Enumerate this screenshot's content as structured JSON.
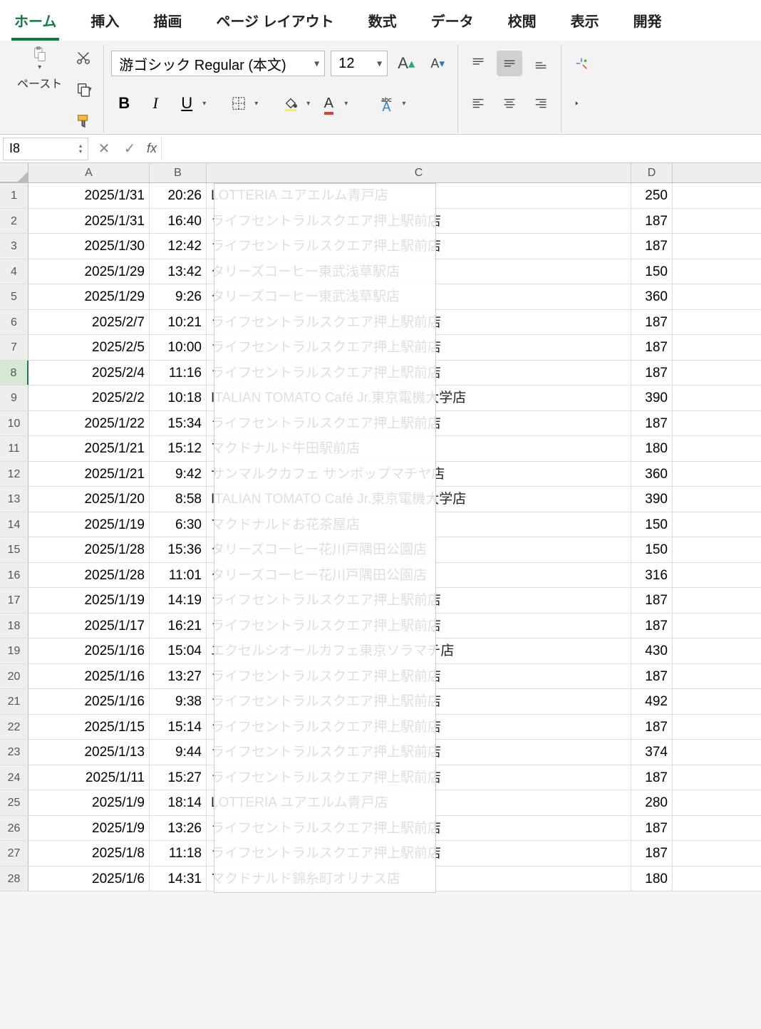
{
  "ribbon": {
    "tabs": [
      "ホーム",
      "挿入",
      "描画",
      "ページ レイアウト",
      "数式",
      "データ",
      "校閲",
      "表示",
      "開発"
    ],
    "activeTab": 0,
    "pasteLabel": "ペースト",
    "fontName": "游ゴシック Regular (本文)",
    "fontSize": "12"
  },
  "nameBox": "I8",
  "formula": "",
  "columns": [
    "A",
    "B",
    "C",
    "D"
  ],
  "rows": [
    {
      "n": 1,
      "a": "2025/1/31",
      "b": "20:26",
      "c": "LOTTERIA ユアエルム青戸店",
      "d": "250"
    },
    {
      "n": 2,
      "a": "2025/1/31",
      "b": "16:40",
      "c": "ライフセントラルスクエア押上駅前店",
      "d": "187"
    },
    {
      "n": 3,
      "a": "2025/1/30",
      "b": "12:42",
      "c": "ライフセントラルスクエア押上駅前店",
      "d": "187"
    },
    {
      "n": 4,
      "a": "2025/1/29",
      "b": "13:42",
      "c": "タリーズコーヒー東武浅草駅店",
      "d": "150"
    },
    {
      "n": 5,
      "a": "2025/1/29",
      "b": "9:26",
      "c": "タリーズコーヒー東武浅草駅店",
      "d": "360"
    },
    {
      "n": 6,
      "a": "2025/2/7",
      "b": "10:21",
      "c": "ライフセントラルスクエア押上駅前店",
      "d": "187"
    },
    {
      "n": 7,
      "a": "2025/2/5",
      "b": "10:00",
      "c": "ライフセントラルスクエア押上駅前店",
      "d": "187"
    },
    {
      "n": 8,
      "a": "2025/2/4",
      "b": "11:16",
      "c": "ライフセントラルスクエア押上駅前店",
      "d": "187",
      "sel": true
    },
    {
      "n": 9,
      "a": "2025/2/2",
      "b": "10:18",
      "c": "ITALIAN TOMATO Café Jr.東京電機大学店",
      "d": "390"
    },
    {
      "n": 10,
      "a": "2025/1/22",
      "b": "15:34",
      "c": "ライフセントラルスクエア押上駅前店",
      "d": "187"
    },
    {
      "n": 11,
      "a": "2025/1/21",
      "b": "15:12",
      "c": "マクドナルド牛田駅前店",
      "d": "180"
    },
    {
      "n": 12,
      "a": "2025/1/21",
      "b": "9:42",
      "c": "サンマルクカフェ サンポップマチヤ店",
      "d": "360"
    },
    {
      "n": 13,
      "a": "2025/1/20",
      "b": "8:58",
      "c": "ITALIAN TOMATO Café Jr.東京電機大学店",
      "d": "390"
    },
    {
      "n": 14,
      "a": "2025/1/19",
      "b": "6:30",
      "c": "マクドナルドお花茶屋店",
      "d": "150"
    },
    {
      "n": 15,
      "a": "2025/1/28",
      "b": "15:36",
      "c": "タリーズコーヒー花川戸隅田公園店",
      "d": "150"
    },
    {
      "n": 16,
      "a": "2025/1/28",
      "b": "11:01",
      "c": "タリーズコーヒー花川戸隅田公園店",
      "d": "316"
    },
    {
      "n": 17,
      "a": "2025/1/19",
      "b": "14:19",
      "c": "ライフセントラルスクエア押上駅前店",
      "d": "187"
    },
    {
      "n": 18,
      "a": "2025/1/17",
      "b": "16:21",
      "c": "ライフセントラルスクエア押上駅前店",
      "d": "187"
    },
    {
      "n": 19,
      "a": "2025/1/16",
      "b": "15:04",
      "c": "エクセルシオールカフェ東京ソラマチ店",
      "d": "430"
    },
    {
      "n": 20,
      "a": "2025/1/16",
      "b": "13:27",
      "c": "ライフセントラルスクエア押上駅前店",
      "d": "187"
    },
    {
      "n": 21,
      "a": "2025/1/16",
      "b": "9:38",
      "c": "ライフセントラルスクエア押上駅前店",
      "d": "492"
    },
    {
      "n": 22,
      "a": "2025/1/15",
      "b": "15:14",
      "c": "ライフセントラルスクエア押上駅前店",
      "d": "187"
    },
    {
      "n": 23,
      "a": "2025/1/13",
      "b": "9:44",
      "c": "ライフセントラルスクエア押上駅前店",
      "d": "374"
    },
    {
      "n": 24,
      "a": "2025/1/11",
      "b": "15:27",
      "c": "ライフセントラルスクエア押上駅前店",
      "d": "187"
    },
    {
      "n": 25,
      "a": "2025/1/9",
      "b": "18:14",
      "c": "LOTTERIA ユアエルム青戸店",
      "d": "280"
    },
    {
      "n": 26,
      "a": "2025/1/9",
      "b": "13:26",
      "c": "ライフセントラルスクエア押上駅前店",
      "d": "187"
    },
    {
      "n": 27,
      "a": "2025/1/8",
      "b": "11:18",
      "c": "ライフセントラルスクエア押上駅前店",
      "d": "187"
    },
    {
      "n": 28,
      "a": "2025/1/6",
      "b": "14:31",
      "c": "マクドナルド錦糸町オリナス店",
      "d": "180"
    }
  ]
}
